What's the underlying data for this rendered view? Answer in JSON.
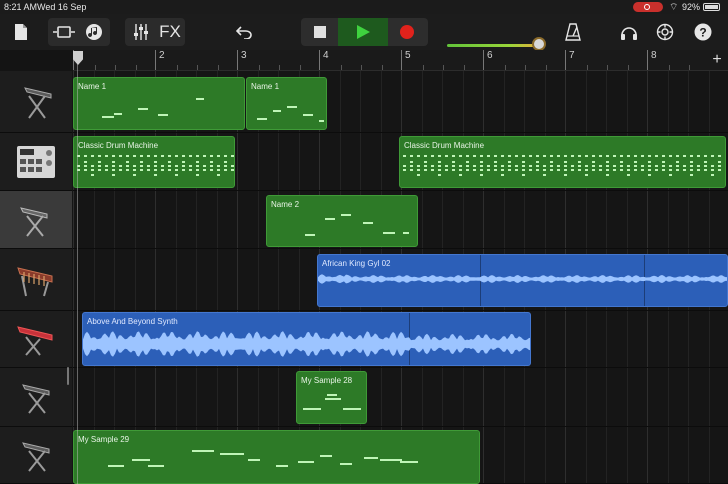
{
  "status_bar": {
    "time": "8:21 AM",
    "date": "Wed 16 Sep",
    "battery": "92%"
  },
  "toolbar": {
    "fx_label": "FX",
    "buttons": [
      "my-songs",
      "browser-view",
      "loop-browser",
      "mixer",
      "fx",
      "undo",
      "stop",
      "play",
      "record",
      "metronome",
      "loop-settings",
      "settings",
      "help"
    ],
    "volume_level": 0.93
  },
  "ruler": {
    "bars": [
      "",
      "2",
      "3",
      "4",
      "5",
      "6",
      "7",
      "8"
    ]
  },
  "tracks": [
    {
      "instrument": "keyboard",
      "selected": false,
      "regions": [
        {
          "name": "Name 1",
          "type": "midi"
        },
        {
          "name": "Name 1",
          "type": "midi"
        }
      ]
    },
    {
      "instrument": "drum-machine",
      "selected": false,
      "regions": [
        {
          "name": "Classic Drum Machine",
          "type": "midi"
        },
        {
          "name": "Classic Drum Machine",
          "type": "midi"
        }
      ]
    },
    {
      "instrument": "keyboard",
      "selected": true,
      "regions": [
        {
          "name": "Name 2",
          "type": "midi"
        }
      ]
    },
    {
      "instrument": "marimba",
      "selected": false,
      "regions": [
        {
          "name": "African King Gyl 02",
          "type": "audio"
        }
      ]
    },
    {
      "instrument": "synth-keyboard",
      "selected": false,
      "regions": [
        {
          "name": "Above And Beyond Synth",
          "type": "audio"
        }
      ]
    },
    {
      "instrument": "keyboard",
      "selected": false,
      "regions": [
        {
          "name": "My Sample 28",
          "type": "midi"
        }
      ]
    },
    {
      "instrument": "keyboard",
      "selected": false,
      "regions": [
        {
          "name": "My Sample 29",
          "type": "midi"
        }
      ]
    }
  ],
  "colors": {
    "midi_region": "#2d7a27",
    "audio_region": "#2c5fb8",
    "play_green": "#3fd23f",
    "record_red": "#e0221c"
  }
}
